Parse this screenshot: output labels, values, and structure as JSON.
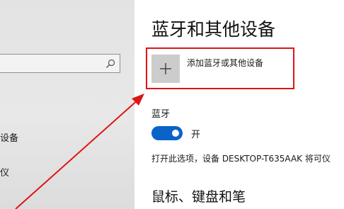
{
  "sidebar": {
    "items": [
      {
        "label": "设备"
      },
      {
        "label": "仪"
      }
    ]
  },
  "main": {
    "title": "蓝牙和其他设备",
    "add_device_label": "添加蓝牙或其他设备",
    "bluetooth_heading": "蓝牙",
    "bluetooth_state_label": "开",
    "bluetooth_on": true,
    "description": "打开此选项，设备 DESKTOP-T635AAK 将可仪",
    "next_section_title": "鼠标、键盘和笔"
  },
  "colors": {
    "accent": "#0a64c8",
    "annotation": "#e01414"
  }
}
